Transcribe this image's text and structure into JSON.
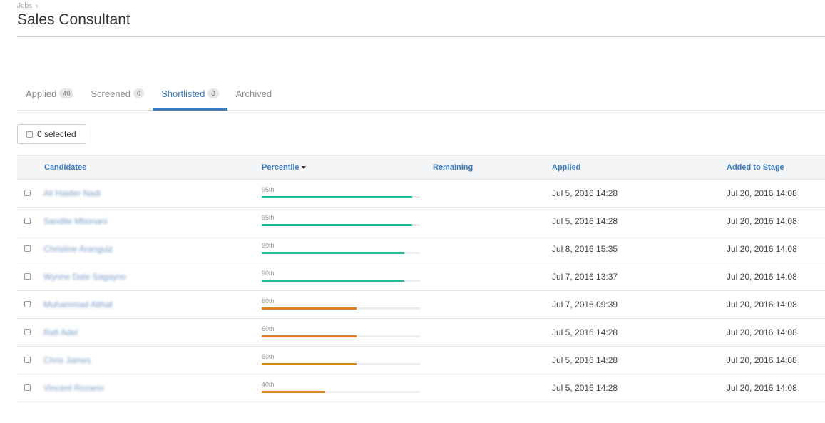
{
  "breadcrumb": {
    "parent": "Jobs",
    "separator": "›"
  },
  "page_title": "Sales Consultant",
  "tabs": [
    {
      "label": "Applied",
      "count": "40",
      "active": false
    },
    {
      "label": "Screened",
      "count": "0",
      "active": false
    },
    {
      "label": "Shortlisted",
      "count": "8",
      "active": true
    },
    {
      "label": "Archived",
      "count": "",
      "active": false
    }
  ],
  "selection": {
    "label": "0 selected"
  },
  "columns": {
    "candidates": "Candidates",
    "percentile": "Percentile",
    "remaining": "Remaining",
    "applied": "Applied",
    "added_to_stage": "Added to Stage"
  },
  "colors": {
    "accent": "#3b7bbf",
    "high": "#1fb995",
    "mid": "#e07f20"
  },
  "rows": [
    {
      "name": "Ali Haider Nadi",
      "percentile_label": "95th",
      "percentile": 95,
      "applied": "Jul 5, 2016 14:28",
      "added": "Jul 20, 2016 14:08"
    },
    {
      "name": "Sandile Mbonani",
      "percentile_label": "95th",
      "percentile": 95,
      "applied": "Jul 5, 2016 14:28",
      "added": "Jul 20, 2016 14:08"
    },
    {
      "name": "Christine Aranguiz",
      "percentile_label": "90th",
      "percentile": 90,
      "applied": "Jul 8, 2016 15:35",
      "added": "Jul 20, 2016 14:08"
    },
    {
      "name": "Wynne Dale Sagayno",
      "percentile_label": "90th",
      "percentile": 90,
      "applied": "Jul 7, 2016 13:37",
      "added": "Jul 20, 2016 14:08"
    },
    {
      "name": "Muhammad Althaf",
      "percentile_label": "60th",
      "percentile": 60,
      "applied": "Jul 7, 2016 09:39",
      "added": "Jul 20, 2016 14:08"
    },
    {
      "name": "Rafi Adel",
      "percentile_label": "60th",
      "percentile": 60,
      "applied": "Jul 5, 2016 14:28",
      "added": "Jul 20, 2016 14:08"
    },
    {
      "name": "Chris James",
      "percentile_label": "60th",
      "percentile": 60,
      "applied": "Jul 5, 2016 14:28",
      "added": "Jul 20, 2016 14:08"
    },
    {
      "name": "Vincent Rozario",
      "percentile_label": "40th",
      "percentile": 40,
      "applied": "Jul 5, 2016 14:28",
      "added": "Jul 20, 2016 14:08"
    }
  ]
}
